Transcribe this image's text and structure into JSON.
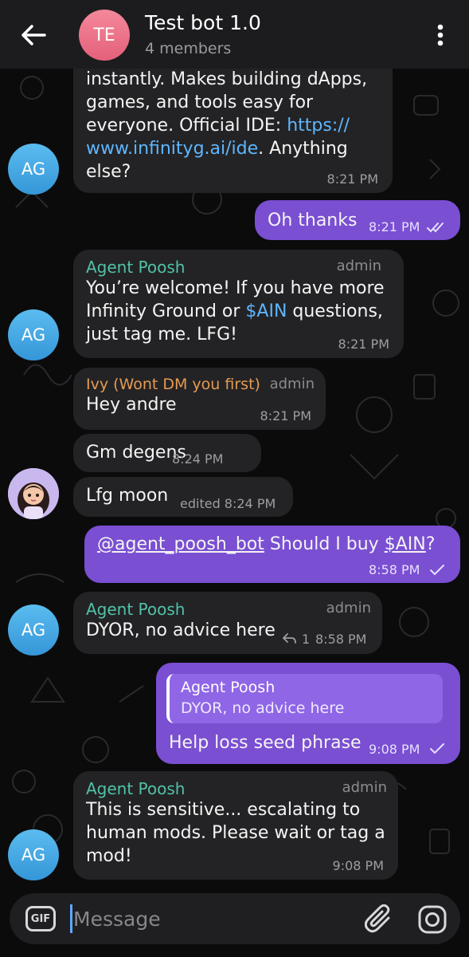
{
  "header": {
    "avatar_initials": "TE",
    "title": "Test bot 1.0",
    "subtitle": "4 members"
  },
  "messages": [
    {
      "id": "m1",
      "direction": "in",
      "avatar": "AG",
      "lines": [
        "instantly. Makes building dApps,",
        "games, and tools easy for",
        "everyone. Official IDE: "
      ],
      "link_part1": "https://",
      "link_part2": "www.infinityg.ai/ide",
      "tail": ". Anything",
      "last": "else?",
      "time": "8:21 PM"
    },
    {
      "id": "m2",
      "direction": "out",
      "text": "Oh thanks",
      "time": "8:21 PM",
      "status": "read-icon"
    },
    {
      "id": "m3",
      "direction": "in",
      "sender": "Agent Poosh",
      "role": "admin",
      "avatar": "AG",
      "line1": "You’re welcome! If you have more",
      "line2_prefix": "Infinity Ground or ",
      "line2_link": "$AIN",
      "line2_suffix": " questions,",
      "line3": "just tag me. LFG!",
      "time": "8:21 PM"
    },
    {
      "id": "m4",
      "direction": "in",
      "sender": "Ivy (Wont DM you first)",
      "role": "admin",
      "text": "Hey andre",
      "time": "8:21 PM"
    },
    {
      "id": "m5",
      "direction": "in",
      "text": "Gm degens",
      "time": "8:24 PM"
    },
    {
      "id": "m6",
      "direction": "in",
      "text": "Lfg moon",
      "time": "edited 8:24 PM",
      "avatar_kind": "photo"
    },
    {
      "id": "m7",
      "direction": "out",
      "mention": "@agent_poosh_bot",
      "middle": " Should I buy ",
      "cashtag": "$AIN",
      "end": "?",
      "time": "8:58 PM",
      "status": "sent-icon"
    },
    {
      "id": "m8",
      "direction": "in",
      "sender": "Agent Poosh",
      "role": "admin",
      "avatar": "AG",
      "text": "DYOR, no advice here",
      "replies": "1",
      "time": "8:58 PM"
    },
    {
      "id": "m9",
      "direction": "out",
      "quote_sender": "Agent Poosh",
      "quote_text": "DYOR, no advice here",
      "text": "Help loss seed phrase",
      "time": "9:08 PM",
      "status": "sent-icon"
    },
    {
      "id": "m10",
      "direction": "in",
      "sender": "Agent Poosh",
      "role": "admin",
      "avatar": "AG",
      "line1": "This is sensitive... escalating to",
      "line2": "human mods. Please wait or tag a",
      "line3": "mod!",
      "time": "9:08 PM"
    }
  ],
  "composer": {
    "gif_label": "GIF",
    "placeholder": "Message"
  },
  "colors": {
    "header_bg": "#1c1c1e",
    "incoming_bubble": "#232325",
    "outgoing_bubble": "#7a4fd2",
    "sender_green": "#51c2a8",
    "sender_orange": "#e59b53",
    "link_blue": "#5fb6ff",
    "avatar_pink": "#e4607a",
    "avatar_blue": "#3596d8"
  }
}
